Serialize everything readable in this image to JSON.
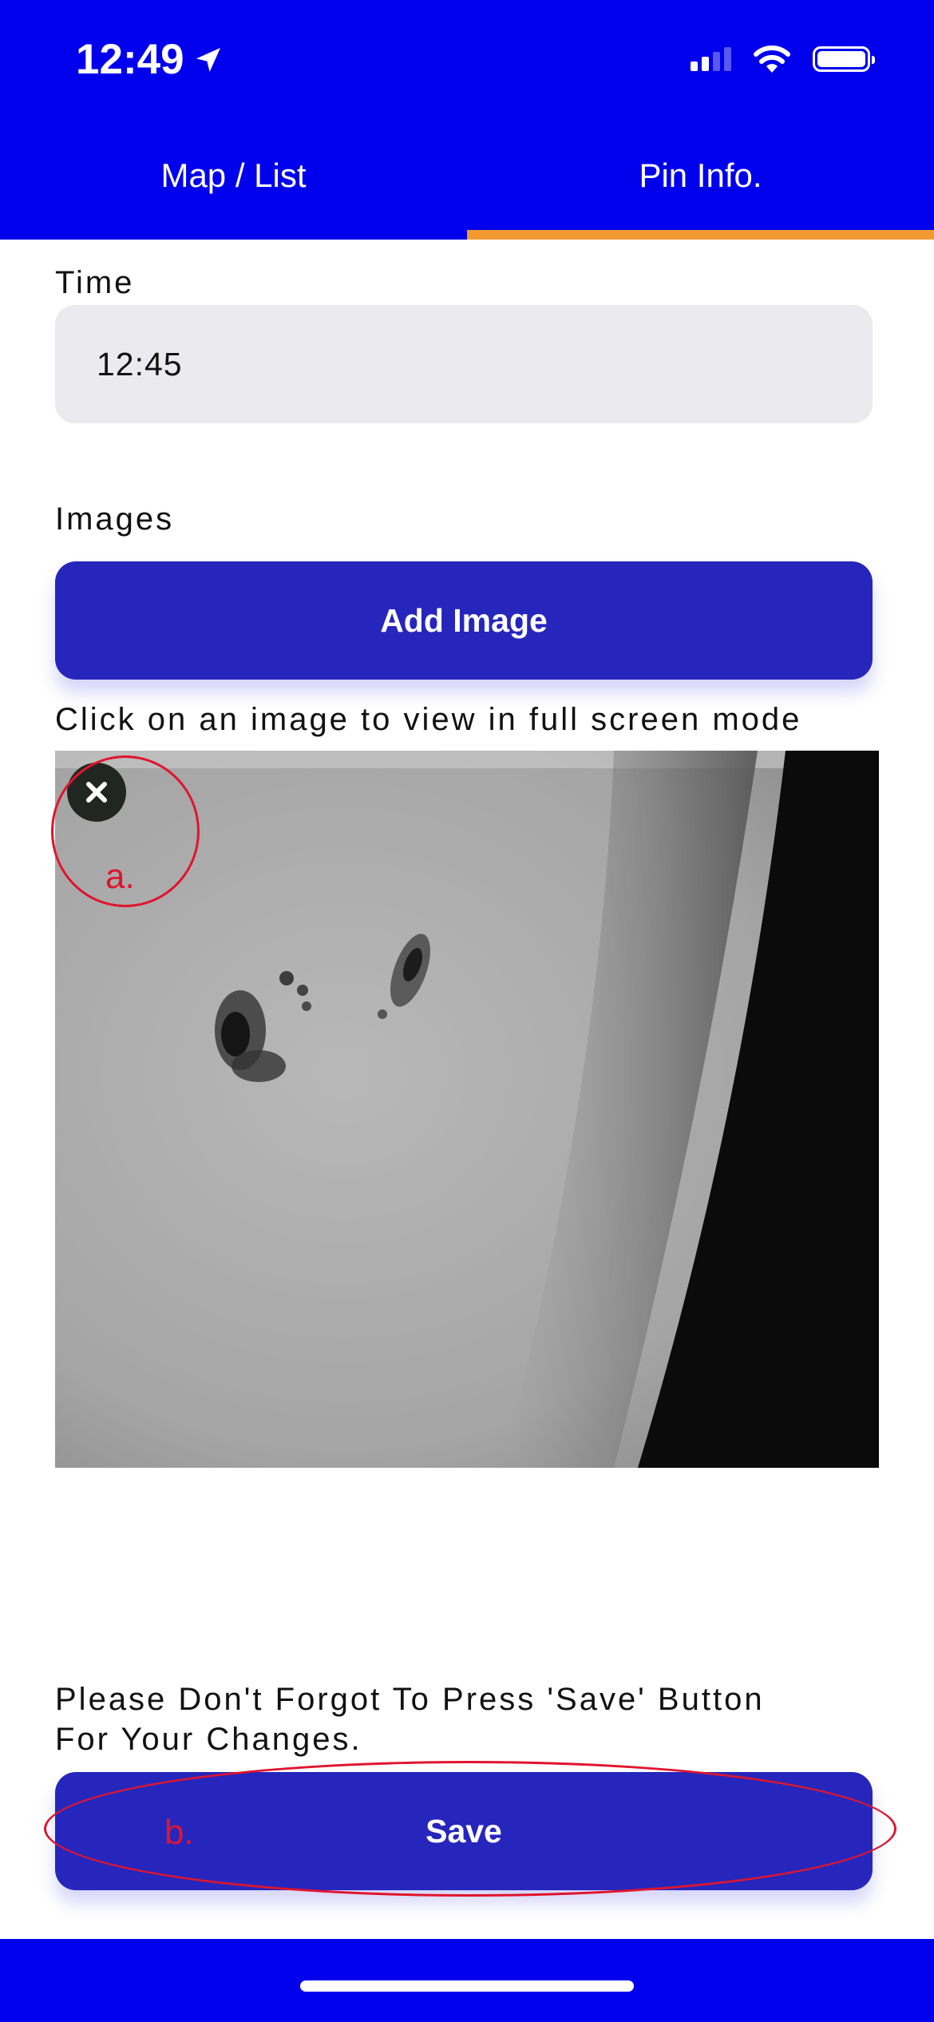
{
  "status_bar": {
    "time": "12:49"
  },
  "tabs": [
    {
      "label": "Map / List",
      "active": false
    },
    {
      "label": "Pin Info.",
      "active": true
    }
  ],
  "form": {
    "time_label": "Time",
    "time_value": "12:45",
    "images_label": "Images",
    "add_image_label": "Add Image",
    "image_hint": "Click on an image to view in full screen mode",
    "save_hint_line1": "Please Don't Forgot To Press 'Save' Button",
    "save_hint_line2": "For Your Changes.",
    "save_label": "Save"
  },
  "annotations": {
    "a": "a.",
    "b": "b."
  },
  "colors": {
    "header": "#0000ec",
    "button": "#2626bc",
    "tab_indicator": "#f29a31",
    "annotation": "#e0142d"
  }
}
